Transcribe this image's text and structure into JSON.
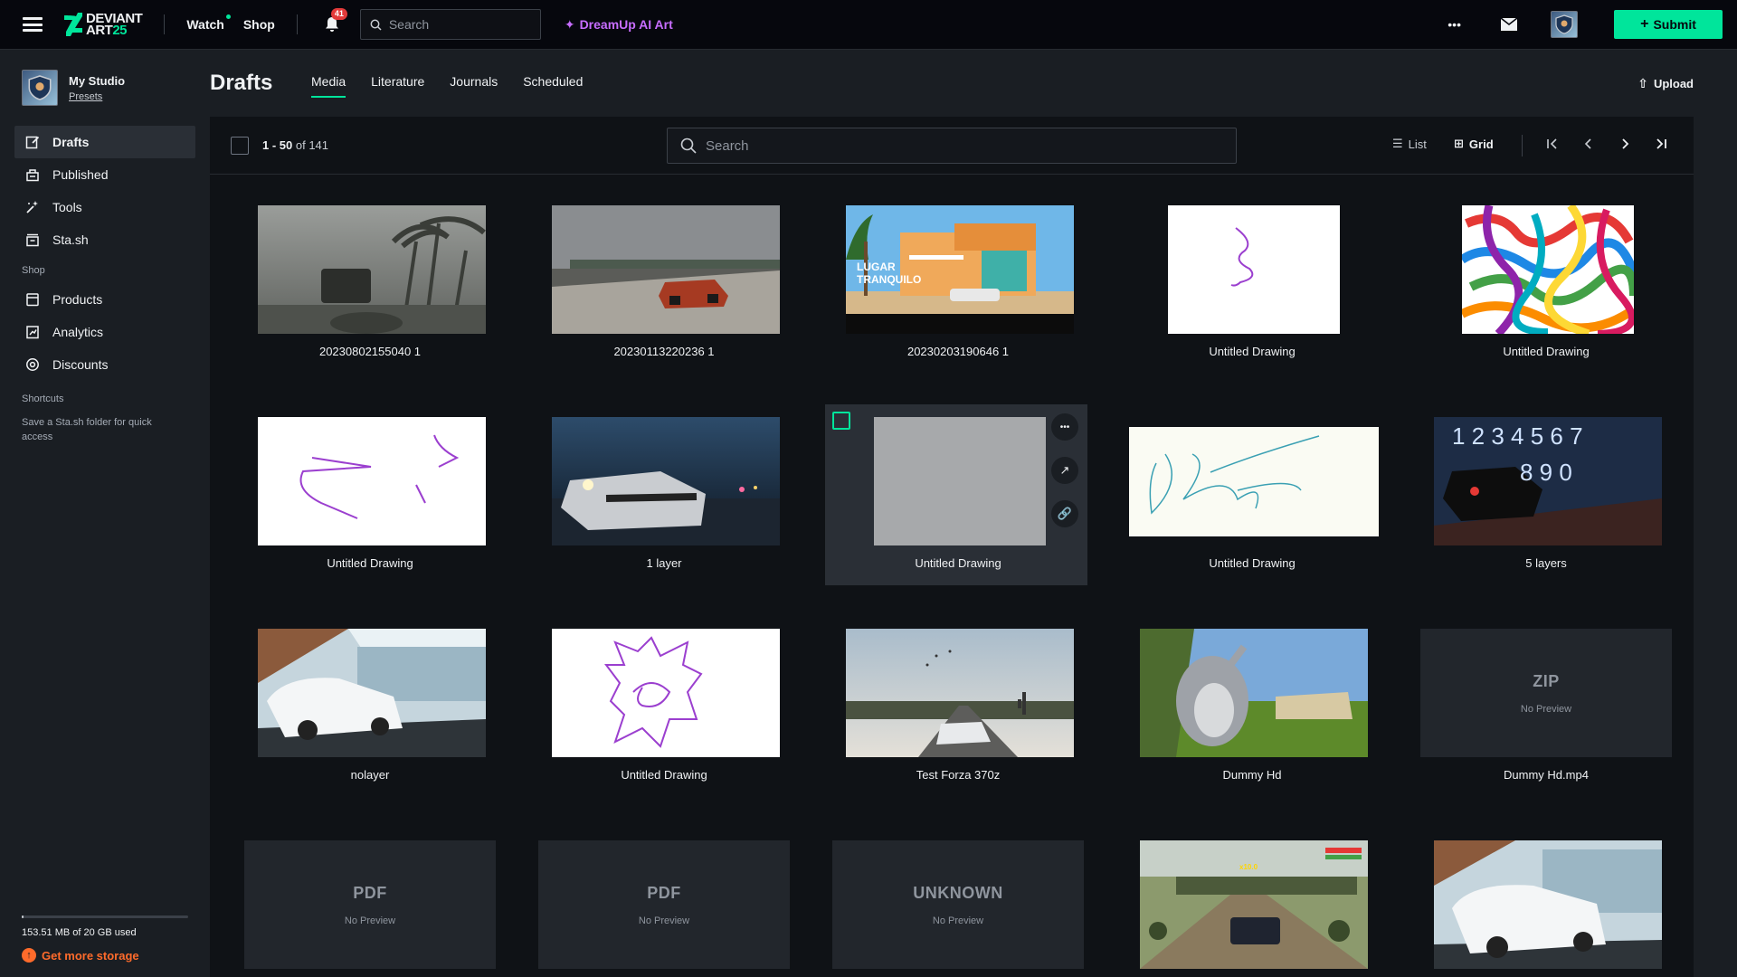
{
  "header": {
    "logo_line1": "DEVIANT",
    "logo_line2a": "ART",
    "logo_line2b": "25",
    "watch_label": "Watch",
    "shop_label": "Shop",
    "notifications_count": "41",
    "search_placeholder": "Search",
    "dreamup_label": "DreamUp AI Art",
    "more_glyph": "•••",
    "submit_label": "Submit",
    "accent_color": "#00e59b"
  },
  "sidebar": {
    "studio_name": "My Studio",
    "presets_link": "Presets",
    "items": [
      {
        "label": "Drafts",
        "icon": "drafts-icon"
      },
      {
        "label": "Published",
        "icon": "published-icon"
      },
      {
        "label": "Tools",
        "icon": "tools-icon"
      },
      {
        "label": "Sta.sh",
        "icon": "stash-icon"
      }
    ],
    "shop_section": "Shop",
    "shop_items": [
      {
        "label": "Products",
        "icon": "products-icon"
      },
      {
        "label": "Analytics",
        "icon": "analytics-icon"
      },
      {
        "label": "Discounts",
        "icon": "discounts-icon"
      }
    ],
    "shortcuts_section": "Shortcuts",
    "shortcuts_hint": "Save a Sta.sh folder for quick access",
    "storage_used_fraction": 0.0075,
    "storage_text": "153.51 MB of 20 GB used",
    "more_storage": "Get more storage"
  },
  "main": {
    "title": "Drafts",
    "tabs": [
      "Media",
      "Literature",
      "Journals",
      "Scheduled"
    ],
    "active_tab": "Media",
    "upload_label": "Upload",
    "range_label": "1 - 50",
    "total_label": "of 141",
    "search_placeholder": "Search",
    "view_list": "List",
    "view_grid": "Grid",
    "active_view": "Grid"
  },
  "grid": [
    {
      "title": "20230802155040 1",
      "kind": "image",
      "art": "storm-suv"
    },
    {
      "title": "20230113220236 1",
      "kind": "image",
      "art": "road-car"
    },
    {
      "title": "20230203190646 1",
      "kind": "image",
      "art": "lugar-tranquilo",
      "overlay_text": "LUGAR TRANQUILO"
    },
    {
      "title": "Untitled Drawing",
      "kind": "image",
      "art": "scribble-small"
    },
    {
      "title": "Untitled Drawing",
      "kind": "image",
      "art": "color-scribble"
    },
    {
      "title": "Untitled Drawing",
      "kind": "image",
      "art": "purple-strokes"
    },
    {
      "title": "1 layer",
      "kind": "image",
      "art": "night-race"
    },
    {
      "title": "Untitled Drawing",
      "kind": "image",
      "art": "gray-blank",
      "hovered": true
    },
    {
      "title": "Untitled Drawing",
      "kind": "image",
      "art": "teal-scribble"
    },
    {
      "title": "5 layers",
      "kind": "image",
      "art": "numbers-car",
      "overlay_text": "1 2 3 4 5 6 7 8 9 0"
    },
    {
      "title": "nolayer",
      "kind": "image",
      "art": "porsche-room"
    },
    {
      "title": "Untitled Drawing",
      "kind": "image",
      "art": "purple-tangle"
    },
    {
      "title": "Test Forza 370z",
      "kind": "image",
      "art": "desert-370z"
    },
    {
      "title": "Dummy Hd",
      "kind": "image",
      "art": "big-buck"
    },
    {
      "title": "Dummy Hd.mp4",
      "kind": "file",
      "type_label": "ZIP",
      "sub": "No Preview"
    },
    {
      "title": "",
      "kind": "file",
      "type_label": "PDF",
      "sub": "No Preview"
    },
    {
      "title": "",
      "kind": "file",
      "type_label": "PDF",
      "sub": "No Preview"
    },
    {
      "title": "",
      "kind": "file",
      "type_label": "UNKNOWN",
      "sub": "No Preview"
    },
    {
      "title": "",
      "kind": "image",
      "art": "field-car"
    },
    {
      "title": "",
      "kind": "image",
      "art": "porsche-room-2"
    }
  ]
}
